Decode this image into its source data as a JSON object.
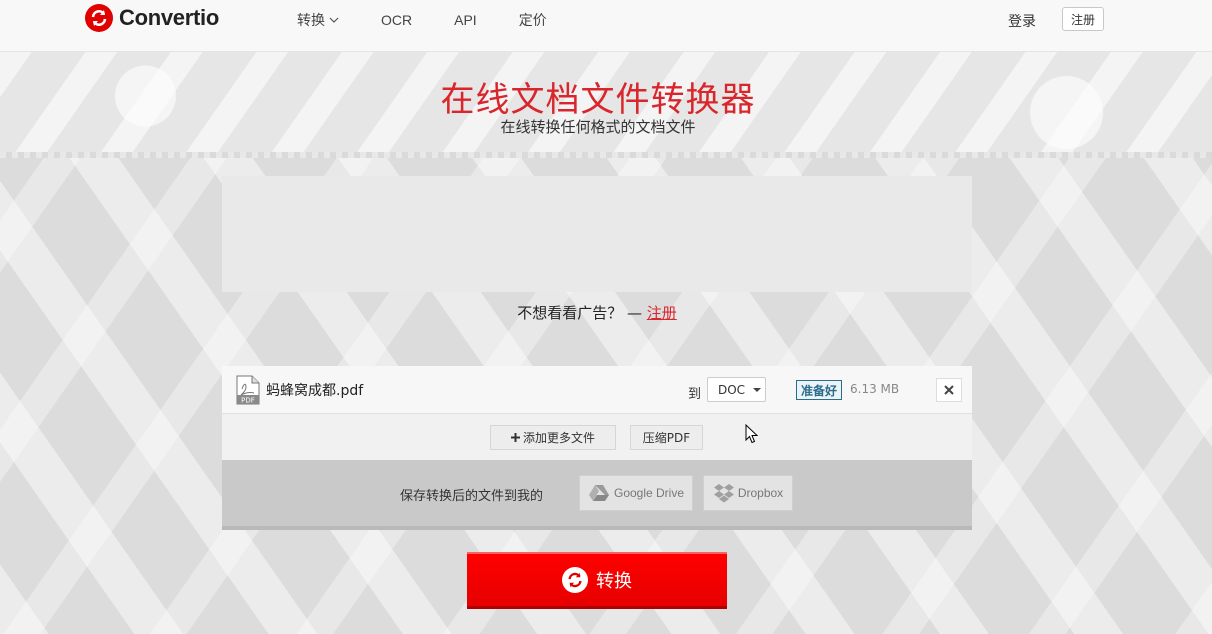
{
  "header": {
    "logo_text": "Convertio",
    "nav": [
      {
        "label": "转换",
        "has_dropdown": true
      },
      {
        "label": "OCR"
      },
      {
        "label": "API"
      },
      {
        "label": "定价"
      }
    ],
    "login_label": "登录",
    "register_label": "注册"
  },
  "hero": {
    "title": "在线文档文件转换器",
    "subtitle": "在线转换任何格式的文档文件"
  },
  "ad": {
    "prompt": "不想看看广告？ — ",
    "link": "注册"
  },
  "file": {
    "name": "蚂蜂窝成都.pdf",
    "icon": "pdf-file-icon",
    "to_label": "到",
    "target_format": "DOC",
    "status": "准备好",
    "size": "6.13 MB"
  },
  "actions": {
    "add_more_label": "添加更多文件",
    "compress_label": "压缩PDF"
  },
  "save": {
    "label": "保存转换后的文件到我的",
    "google_drive": "Google Drive",
    "dropbox": "Dropbox"
  },
  "convert": {
    "label": "转换"
  },
  "colors": {
    "brand_red": "#e00000",
    "title_red": "#d9262c",
    "status_blue": "#2d6b8a"
  }
}
